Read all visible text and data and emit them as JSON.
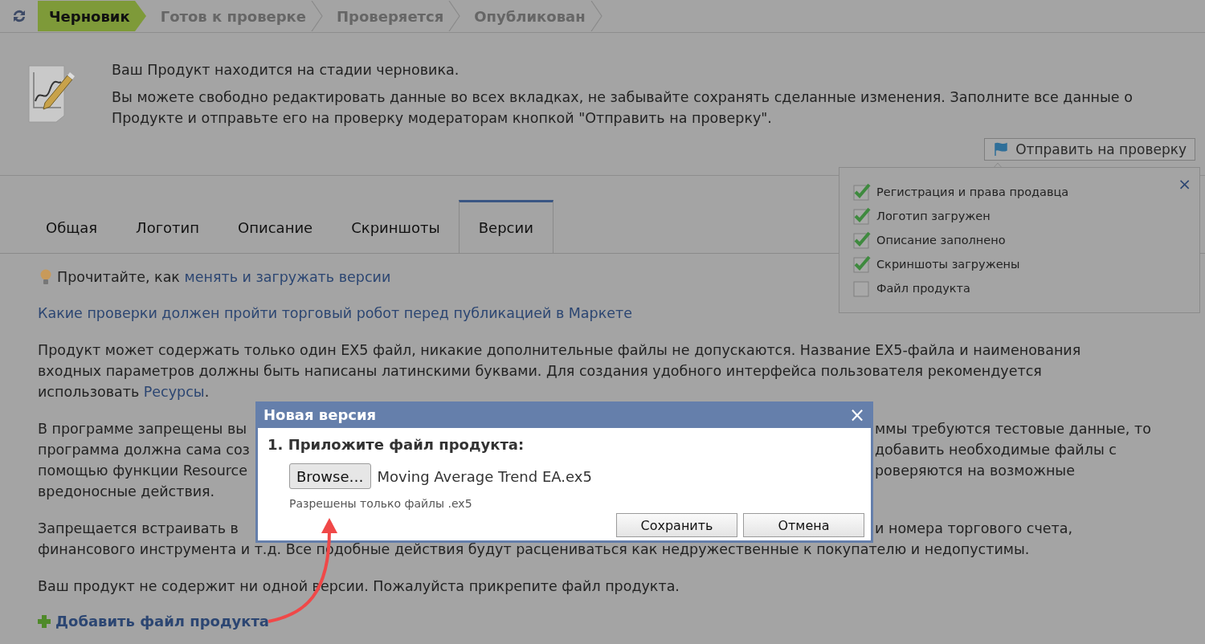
{
  "workflow": {
    "steps": [
      {
        "label": "Черновик",
        "selected": true
      },
      {
        "label": "Готов к проверке",
        "selected": false
      },
      {
        "label": "Проверяется",
        "selected": false
      },
      {
        "label": "Опубликован",
        "selected": false
      }
    ]
  },
  "notice": {
    "title": "Ваш Продукт находится на стадии черновика.",
    "text": "Вы можете свободно редактировать данные во всех вкладках, не забывайте сохранять сделанные изменения. Заполните все данные о Продукте и отправьте его на проверку модераторам кнопкой \"Отправить на проверку\".",
    "button": "Отправить на проверку"
  },
  "checklist": {
    "close": "×",
    "items": [
      {
        "label": "Регистрация и права продавца",
        "checked": true
      },
      {
        "label": "Логотип загружен",
        "checked": true
      },
      {
        "label": "Описание заполнено",
        "checked": true
      },
      {
        "label": "Скриншоты загружены",
        "checked": true
      },
      {
        "label": "Файл продукта",
        "checked": false
      }
    ]
  },
  "tabs": [
    {
      "label": "Общая",
      "selected": false
    },
    {
      "label": "Логотип",
      "selected": false
    },
    {
      "label": "Описание",
      "selected": false
    },
    {
      "label": "Скриншоты",
      "selected": false
    },
    {
      "label": "Версии",
      "selected": true
    }
  ],
  "content": {
    "tip": {
      "prefix": "Прочитайте, как ",
      "link": "менять и загружать версии"
    },
    "checks_link": "Какие проверки должен пройти торговый робот перед публикацией в Маркете",
    "rules": {
      "text": "Продукт может содержать только один EX5 файл, никакие дополнительные файлы не допускаются. Название EX5-файла и наименования входных параметров должны быть написаны латинскими буквами. Для создания удобного интерфейса пользователя рекомендуется использовать ",
      "link": "Ресурсы",
      "suffix": "."
    },
    "covered_paragraphs": [
      {
        "lines": [
          {
            "left": "В программе запрещены вы",
            "right": "ммы требуются тестовые данные, то"
          },
          {
            "left": "программа должна сама соз",
            "right": "добавить необходимые файлы с"
          },
          {
            "left": "помощью функции Resource",
            "right": "роверяются на возможные"
          },
          {
            "left": "вредоносные действия."
          }
        ]
      },
      {
        "lines": [
          {
            "left": "Запрещается встраивать в",
            "right": "и номера торгового счета,"
          },
          {
            "left": "финансового инструмента и т.д. Все подобные действия будут расцениваться как недружественные к покупателю и недопустимы."
          }
        ]
      }
    ],
    "status": "Ваш продукт не содержит ни одной версии. Пожалуйста прикрепите файл продукта.",
    "add_link": "Добавить файл продукта"
  },
  "dialog": {
    "title": "Новая версия",
    "close": "×",
    "step": "1. Приложите файл продукта:",
    "browse": "Browse…",
    "file": "Moving Average Trend EA.ex5",
    "hint": "Разрешены только файлы .ex5",
    "buttons": [
      "Сохранить",
      "Отмена"
    ]
  }
}
